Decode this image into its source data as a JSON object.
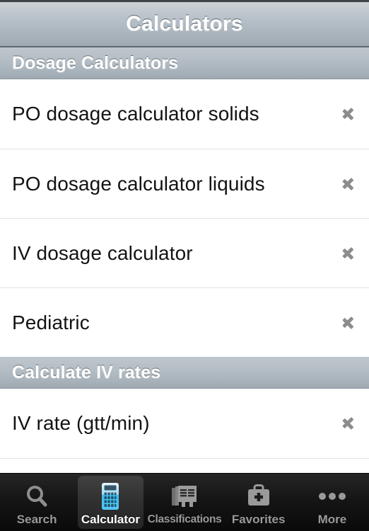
{
  "navbar": {
    "title": "Calculators"
  },
  "sections": [
    {
      "header": "Dosage Calculators",
      "rows": [
        {
          "label": "PO dosage calculator solids",
          "accessory": "chevron-right-icon"
        },
        {
          "label": "PO dosage calculator liquids",
          "accessory": "chevron-right-icon"
        },
        {
          "label": "IV dosage calculator",
          "accessory": "chevron-right-icon"
        },
        {
          "label": "Pediatric",
          "accessory": "chevron-right-icon"
        }
      ]
    },
    {
      "header": "Calculate IV rates",
      "rows": [
        {
          "label": "IV rate (gtt/min)",
          "accessory": "chevron-right-icon"
        }
      ]
    }
  ],
  "tabbar": {
    "active_index": 1,
    "tabs": [
      {
        "label": "Search",
        "icon": "search-icon"
      },
      {
        "label": "Calculator",
        "icon": "calculator-icon"
      },
      {
        "label": "Classifications",
        "icon": "classifications-icon"
      },
      {
        "label": "Favorites",
        "icon": "medical-bag-icon"
      },
      {
        "label": "More",
        "icon": "ellipsis-icon"
      }
    ]
  },
  "colors": {
    "navbar_top": "#cdd4d9",
    "navbar_bottom": "#9fa9b2",
    "section_header_top": "#bfc7cd",
    "section_header_bottom": "#9fa9b2",
    "row_background": "#ffffff",
    "row_text": "#131313",
    "separator": "#e2e2e2",
    "chevron": "#8c8c8c",
    "tabbar_background": "#151515",
    "tab_label_inactive": "#9a9a9a",
    "tab_label_active": "#ffffff",
    "tab_active_accent": "#4fc3f7"
  }
}
